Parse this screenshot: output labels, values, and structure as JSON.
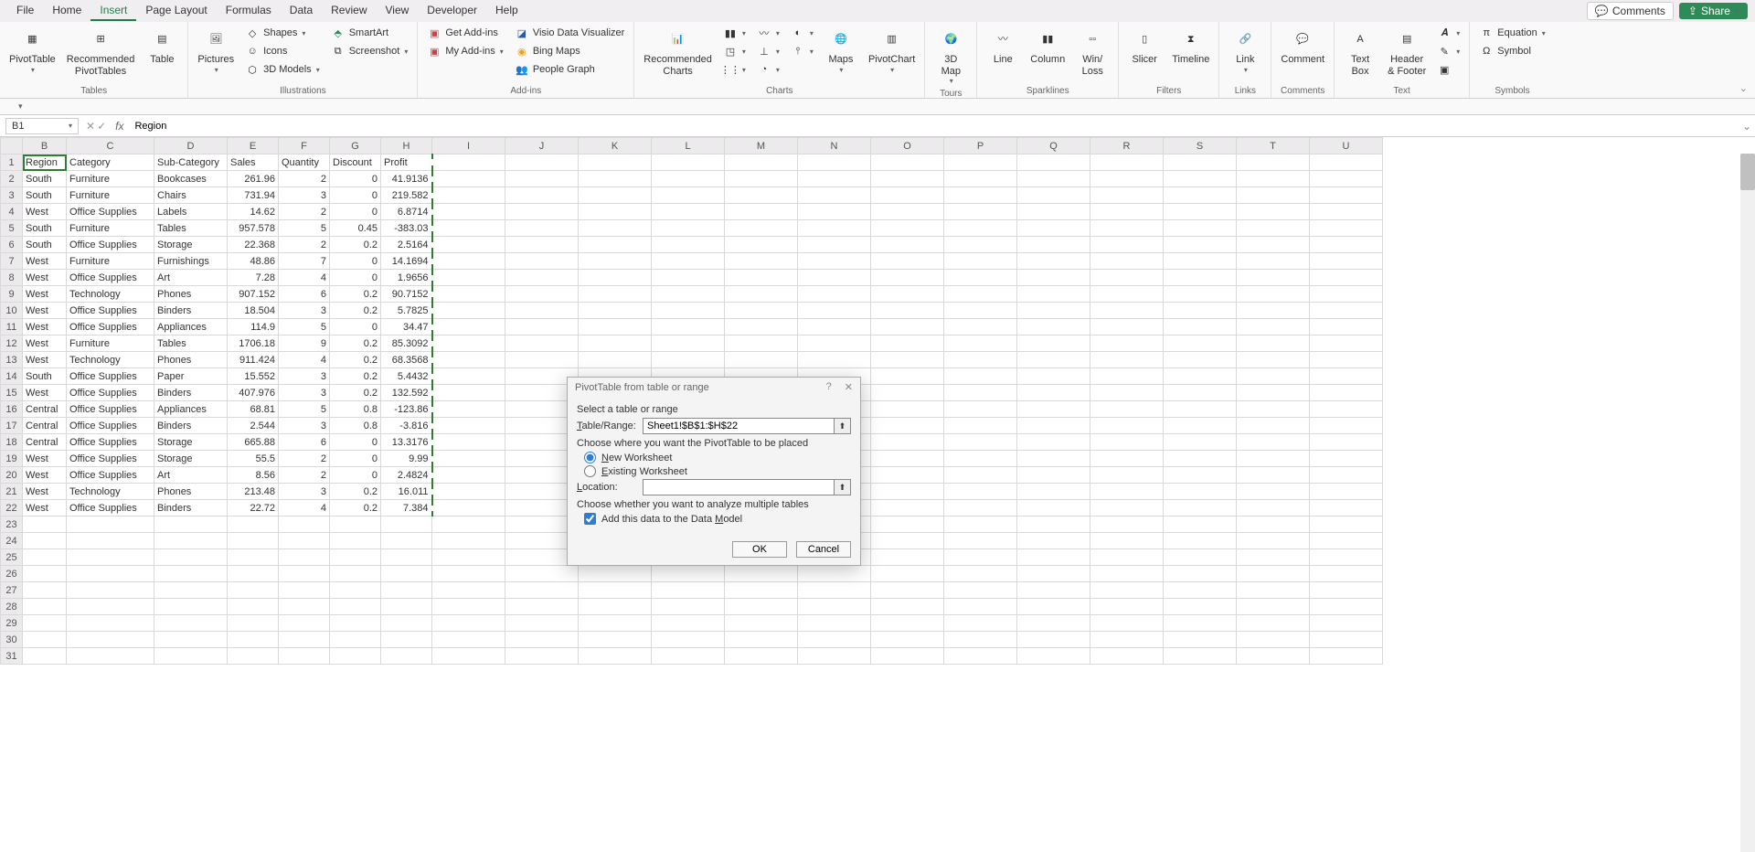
{
  "menu": {
    "items": [
      "File",
      "Home",
      "Insert",
      "Page Layout",
      "Formulas",
      "Data",
      "Review",
      "View",
      "Developer",
      "Help"
    ],
    "active": "Insert",
    "comments": "Comments",
    "share": "Share"
  },
  "ribbon": {
    "tables": {
      "label": "Tables",
      "pivottable": "PivotTable",
      "rec_pivot": "Recommended\nPivotTables",
      "table": "Table"
    },
    "illustrations": {
      "label": "Illustrations",
      "pictures": "Pictures",
      "shapes": "Shapes",
      "icons": "Icons",
      "models": "3D Models",
      "smartart": "SmartArt",
      "screenshot": "Screenshot"
    },
    "addins": {
      "label": "Add-ins",
      "get": "Get Add-ins",
      "my": "My Add-ins",
      "visio": "Visio Data Visualizer",
      "bing": "Bing Maps",
      "people": "People Graph"
    },
    "charts": {
      "label": "Charts",
      "rec": "Recommended\nCharts",
      "maps": "Maps",
      "pivotchart": "PivotChart"
    },
    "tours": {
      "label": "Tours",
      "map3d": "3D\nMap"
    },
    "sparklines": {
      "label": "Sparklines",
      "line": "Line",
      "column": "Column",
      "winloss": "Win/\nLoss"
    },
    "filters": {
      "label": "Filters",
      "slicer": "Slicer",
      "timeline": "Timeline"
    },
    "links": {
      "label": "Links",
      "link": "Link"
    },
    "comments": {
      "label": "Comments",
      "comment": "Comment"
    },
    "text": {
      "label": "Text",
      "textbox": "Text\nBox",
      "header": "Header\n& Footer"
    },
    "symbols": {
      "label": "Symbols",
      "equation": "Equation",
      "symbol": "Symbol"
    }
  },
  "namebox": "B1",
  "formula_value": "Region",
  "columns": [
    "B",
    "C",
    "D",
    "E",
    "F",
    "G",
    "H",
    "I",
    "J",
    "K",
    "L",
    "M",
    "N",
    "O",
    "P",
    "Q",
    "R",
    "S",
    "T",
    "U"
  ],
  "headers": [
    "Region",
    "Category",
    "Sub-Category",
    "Sales",
    "Quantity",
    "Discount",
    "Profit"
  ],
  "rows": [
    [
      "South",
      "Furniture",
      "Bookcases",
      "261.96",
      "2",
      "0",
      "41.9136"
    ],
    [
      "South",
      "Furniture",
      "Chairs",
      "731.94",
      "3",
      "0",
      "219.582"
    ],
    [
      "West",
      "Office Supplies",
      "Labels",
      "14.62",
      "2",
      "0",
      "6.8714"
    ],
    [
      "South",
      "Furniture",
      "Tables",
      "957.578",
      "5",
      "0.45",
      "-383.03"
    ],
    [
      "South",
      "Office Supplies",
      "Storage",
      "22.368",
      "2",
      "0.2",
      "2.5164"
    ],
    [
      "West",
      "Furniture",
      "Furnishings",
      "48.86",
      "7",
      "0",
      "14.1694"
    ],
    [
      "West",
      "Office Supplies",
      "Art",
      "7.28",
      "4",
      "0",
      "1.9656"
    ],
    [
      "West",
      "Technology",
      "Phones",
      "907.152",
      "6",
      "0.2",
      "90.7152"
    ],
    [
      "West",
      "Office Supplies",
      "Binders",
      "18.504",
      "3",
      "0.2",
      "5.7825"
    ],
    [
      "West",
      "Office Supplies",
      "Appliances",
      "114.9",
      "5",
      "0",
      "34.47"
    ],
    [
      "West",
      "Furniture",
      "Tables",
      "1706.18",
      "9",
      "0.2",
      "85.3092"
    ],
    [
      "West",
      "Technology",
      "Phones",
      "911.424",
      "4",
      "0.2",
      "68.3568"
    ],
    [
      "South",
      "Office Supplies",
      "Paper",
      "15.552",
      "3",
      "0.2",
      "5.4432"
    ],
    [
      "West",
      "Office Supplies",
      "Binders",
      "407.976",
      "3",
      "0.2",
      "132.592"
    ],
    [
      "Central",
      "Office Supplies",
      "Appliances",
      "68.81",
      "5",
      "0.8",
      "-123.86"
    ],
    [
      "Central",
      "Office Supplies",
      "Binders",
      "2.544",
      "3",
      "0.8",
      "-3.816"
    ],
    [
      "Central",
      "Office Supplies",
      "Storage",
      "665.88",
      "6",
      "0",
      "13.3176"
    ],
    [
      "West",
      "Office Supplies",
      "Storage",
      "55.5",
      "2",
      "0",
      "9.99"
    ],
    [
      "West",
      "Office Supplies",
      "Art",
      "8.56",
      "2",
      "0",
      "2.4824"
    ],
    [
      "West",
      "Technology",
      "Phones",
      "213.48",
      "3",
      "0.2",
      "16.011"
    ],
    [
      "West",
      "Office Supplies",
      "Binders",
      "22.72",
      "4",
      "0.2",
      "7.384"
    ]
  ],
  "empty_rows": 9,
  "dialog": {
    "title": "PivotTable from table or range",
    "select_label": "Select a table or range",
    "table_range_label": "Table/Range:",
    "table_range_value": "Sheet1!$B$1:$H$22",
    "placement_label": "Choose where you want the PivotTable to be placed",
    "new_ws": "New Worksheet",
    "existing_ws": "Existing Worksheet",
    "location_label": "Location:",
    "location_value": "",
    "multiple_label": "Choose whether you want to analyze multiple tables",
    "add_model": "Add this data to the Data Model",
    "ok": "OK",
    "cancel": "Cancel"
  }
}
